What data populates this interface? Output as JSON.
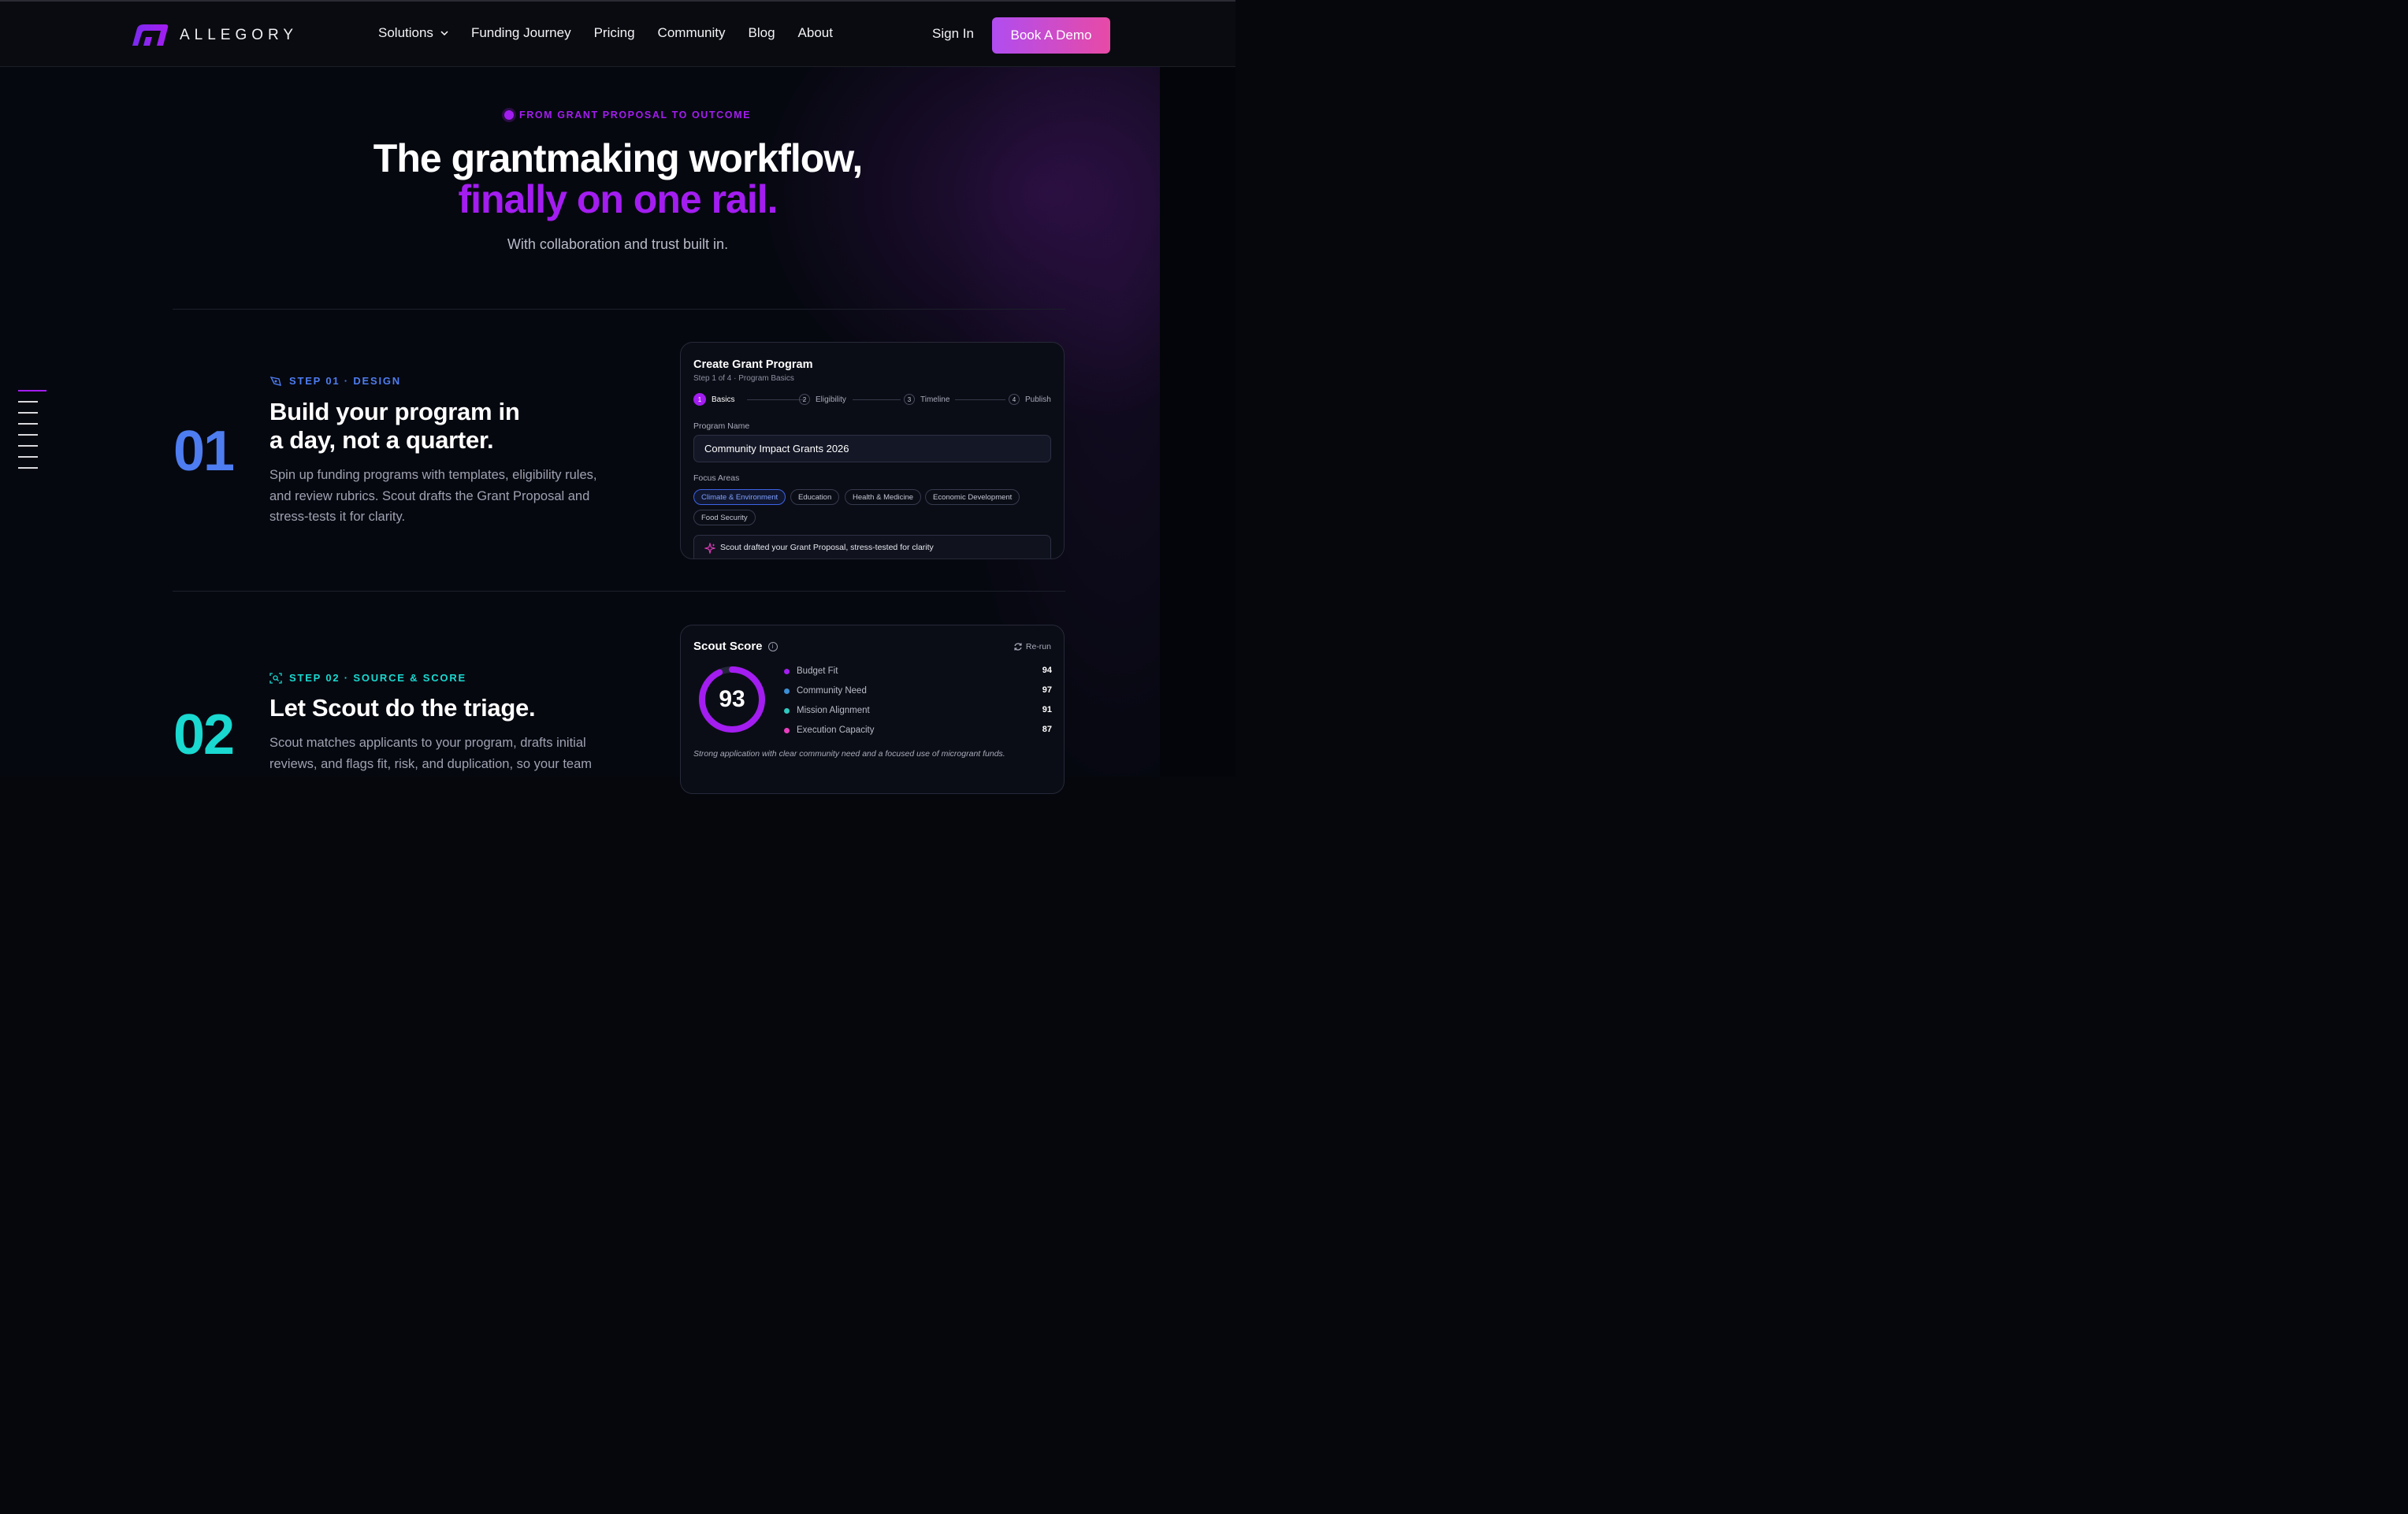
{
  "brand": {
    "name": "ALLEGORY",
    "accent": "#a31df0",
    "gradient": [
      "#b04df0",
      "#e84aa6"
    ]
  },
  "nav": {
    "links": [
      "Solutions",
      "Funding Journey",
      "Pricing",
      "Community",
      "Blog",
      "About"
    ],
    "sign_in": "Sign In",
    "cta": "Book A Demo"
  },
  "hero": {
    "eyebrow": "FROM GRANT PROPOSAL TO OUTCOME",
    "title_line1": "The grantmaking workflow,",
    "title_line2": "finally on one rail.",
    "subtitle": "With collaboration and trust built in."
  },
  "step1": {
    "number": "01",
    "label": "STEP 01 · DESIGN",
    "color": "#4d7df0",
    "title_line1": "Build your program in",
    "title_line2": "a day, not a quarter.",
    "description": "Spin up funding programs with templates, eligibility rules, and review rubrics. Scout drafts the Grant Proposal and stress-tests it for clarity.",
    "card": {
      "title": "Create Grant Program",
      "subtitle": "Step 1 of 4 · Program Basics",
      "steps": [
        {
          "num": "1",
          "label": "Basics"
        },
        {
          "num": "2",
          "label": "Eligibility"
        },
        {
          "num": "3",
          "label": "Timeline"
        },
        {
          "num": "4",
          "label": "Publish"
        }
      ],
      "program_name_label": "Program Name",
      "program_name_value": "Community Impact Grants 2026",
      "focus_label": "Focus Areas",
      "focus_areas": [
        "Climate & Environment",
        "Education",
        "Health & Medicine",
        "Economic Development",
        "Food Security"
      ],
      "note": "Scout drafted your Grant Proposal, stress-tested for clarity"
    }
  },
  "step2": {
    "number": "02",
    "label": "STEP 02 · SOURCE & SCORE",
    "color": "#19d9d0",
    "title": "Let Scout do the triage.",
    "description": "Scout matches applicants to your program, drafts initial reviews, and flags fit, risk, and duplication, so your team",
    "card": {
      "title": "Scout Score",
      "rerun": "Re-run",
      "score": 93,
      "score_max": 100,
      "metrics": [
        {
          "label": "Budget Fit",
          "value": "94",
          "color": "#a31df0"
        },
        {
          "label": "Community Need",
          "value": "97",
          "color": "#3b8fd6"
        },
        {
          "label": "Mission Alignment",
          "value": "91",
          "color": "#2fc9bf"
        },
        {
          "label": "Execution Capacity",
          "value": "87",
          "color": "#e83ec0"
        }
      ],
      "summary": "Strong application with clear community need and a focused use of microgrant funds."
    }
  }
}
